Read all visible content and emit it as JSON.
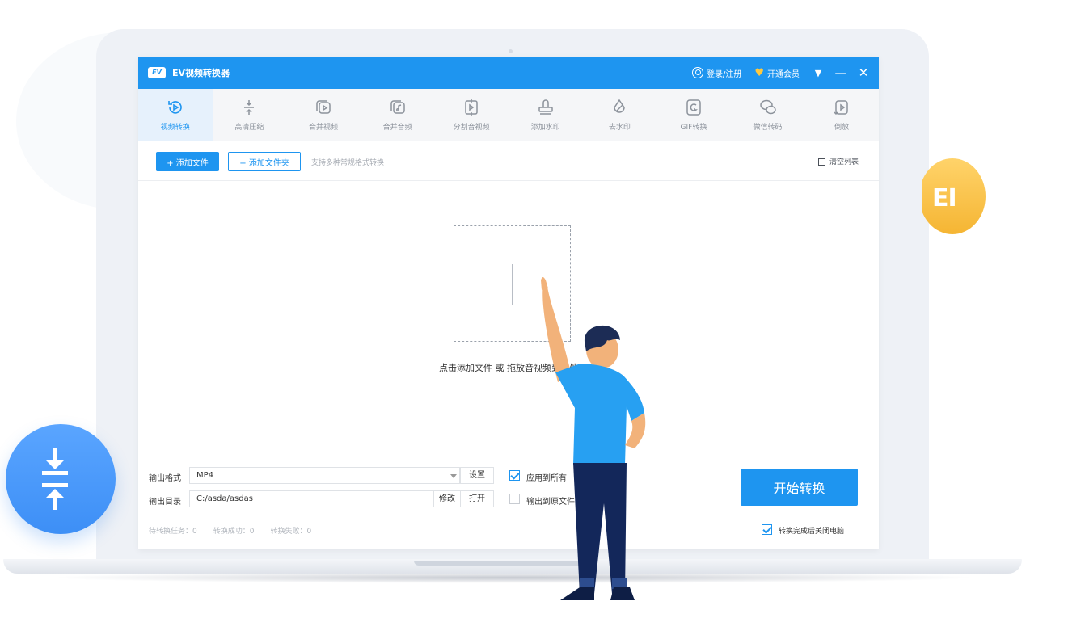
{
  "app": {
    "logo_text": "EV",
    "title": "EV视频转换器",
    "login_label": "登录/注册",
    "vip_label": "开通会员"
  },
  "tools": [
    {
      "label": "视频转换",
      "icon": "video-convert-icon",
      "active": true
    },
    {
      "label": "高清压缩",
      "icon": "compress-icon",
      "active": false
    },
    {
      "label": "合并视频",
      "icon": "merge-video-icon",
      "active": false
    },
    {
      "label": "合并音频",
      "icon": "merge-audio-icon",
      "active": false
    },
    {
      "label": "分割音视频",
      "icon": "split-icon",
      "active": false
    },
    {
      "label": "添加水印",
      "icon": "stamp-icon",
      "active": false
    },
    {
      "label": "去水印",
      "icon": "remove-watermark-icon",
      "active": false
    },
    {
      "label": "GIF转换",
      "icon": "gif-icon",
      "active": false
    },
    {
      "label": "微信转码",
      "icon": "wechat-icon",
      "active": false
    },
    {
      "label": "倒放",
      "icon": "reverse-icon",
      "active": false
    }
  ],
  "actions": {
    "add_file": "+ 添加文件",
    "add_folder": "+ 添加文件夹",
    "hint": "支持多种常规格式转换",
    "clear": "清空列表"
  },
  "drop": {
    "text": "点击添加文件 或 拖放音视频到此处"
  },
  "output": {
    "format_label": "输出格式",
    "format_value": "MP4",
    "settings": "设置",
    "apply_all": "应用到所有",
    "apply_all_checked": true,
    "dir_label": "输出目录",
    "dir_value": "C:/asda/asdas",
    "modify": "修改",
    "open": "打开",
    "to_source": "输出到原文件夹",
    "to_source_checked": false
  },
  "stats": {
    "pending": "待转换任务：0",
    "success": "转换成功：0",
    "failed": "转换失败：0"
  },
  "start_button": "开始转换",
  "shutdown": {
    "label": "转换完成后关闭电脑",
    "checked": true
  },
  "badges": {
    "right_text": "EI"
  },
  "colors": {
    "brand_blue": "#1e95f0",
    "vip_gold": "#ffc83d",
    "badge_gold": "#f5b533"
  }
}
